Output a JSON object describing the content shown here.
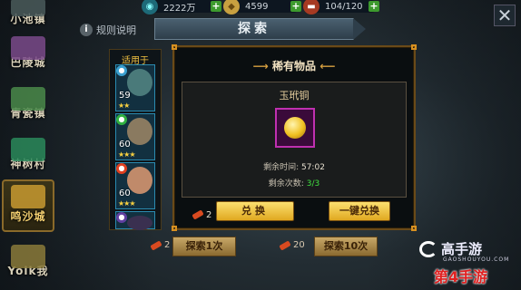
{
  "resources": [
    {
      "icon": "coin-icon",
      "value": "2222万"
    },
    {
      "icon": "gold-icon",
      "value": "4599"
    },
    {
      "icon": "food-icon",
      "value": "104/120"
    }
  ],
  "cities": [
    {
      "label": "小池镇",
      "selected": false,
      "color": "#4a5a5a"
    },
    {
      "label": "巴陵城",
      "selected": false,
      "color": "#7a4a8a"
    },
    {
      "label": "青瓷镇",
      "selected": false,
      "color": "#4a8a4a"
    },
    {
      "label": "神树村",
      "selected": false,
      "color": "#2a8a5a"
    },
    {
      "label": "鸣沙城",
      "selected": true,
      "color": "#c89a30"
    },
    {
      "label": "Yolk我",
      "selected": false,
      "color": "#8a7a3a"
    }
  ],
  "help_label": "规则说明",
  "tab_label": "探索",
  "hero_column": {
    "title": "适用于",
    "heroes": [
      {
        "level": "59",
        "stars": "★★",
        "badge_color": "#3aa0d0",
        "face_color": "#4a7a7a"
      },
      {
        "level": "60",
        "stars": "★★★",
        "badge_color": "#30b040",
        "face_color": "#8a7a60"
      },
      {
        "level": "60",
        "stars": "★★★",
        "badge_color": "#e04020",
        "face_color": "#c08a6a"
      },
      {
        "level": "",
        "stars": "",
        "badge_color": "#6040a0",
        "face_color": "#3a3050"
      }
    ]
  },
  "panel": {
    "title": "稀有物品",
    "item_name": "玉玳铜",
    "time_label": "剩余时间:",
    "time_value": "57:02",
    "count_label": "剩余次数:",
    "count_value": "3/3",
    "cost": "2",
    "exchange_label": "兑换",
    "one_click_label": "一键兑换"
  },
  "explore": {
    "once_cost": "2",
    "once_label": "探索1次",
    "ten_cost": "20",
    "ten_label": "探索10次"
  },
  "watermark": {
    "brand": "高手游",
    "sub": "GAOSHOUYOU.COM",
    "red": "第4手游"
  }
}
